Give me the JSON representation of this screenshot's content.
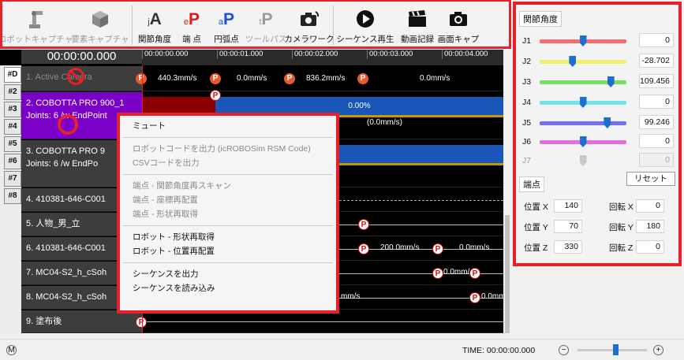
{
  "toolbar": {
    "capture_robot": "ロボットキャプチャ",
    "capture_element": "要素キャプチャ",
    "joint_angle": "関節角度",
    "endpoint": "端 点",
    "arc_point": "円弧点",
    "tool_path": "ツールパス",
    "camera_work": "カメラワーク",
    "play_sequence": "シーケンス再生",
    "record_video": "動画記録",
    "screen_capture": "画面キャプ",
    "icon_glyphs": {
      "joint": "jA",
      "end": "eP",
      "arc": "aP",
      "tool": "tP"
    }
  },
  "timeline": {
    "time": "00:00:00.000",
    "ruler": [
      "00:00:00.000",
      "00:00:01.000",
      "00:00:02.000",
      "00:00:03.000",
      "00:00:04.000"
    ],
    "tabs": [
      "#D",
      "#2",
      "#3",
      "#4",
      "#5",
      "#6",
      "#7",
      "#8"
    ],
    "tracks": [
      {
        "name": "1. Active Camera"
      },
      {
        "name": "2. COBOTTA PRO 900_1",
        "sub": "Joints: 6 /w EndPoint"
      },
      {
        "name": "3. COBOTTA PRO 9",
        "sub": "Joints: 6 /w EndPo"
      },
      {
        "name": "4. 410381-646-C001"
      },
      {
        "name": "5. 人物_男_立"
      },
      {
        "name": "6. 410381-646-C001"
      },
      {
        "name": "7. MC04-S2_h_cSoh"
      },
      {
        "name": "8. MC04-S2_h_cSoh"
      },
      {
        "name": "9. 塗布後"
      }
    ],
    "marker_label": "P",
    "speeds": {
      "t1_a": "440.3mm/s",
      "t1_b": "0.0mm/s",
      "t1_c": "836.2mm/s",
      "t1_d": "0.0mm/s",
      "t2_pct": "0.00%",
      "t2_spd": "(0.0mm/s)",
      "t6_a": "200.0mm/s",
      "t6_b": "0.0mm/s",
      "t7_a": "0.0mm/s",
      "t8_a": "0.0mm/s",
      "t8_b": "mm/s"
    }
  },
  "context_menu": {
    "mute": "ミュート",
    "output_robot_code": "ロボットコードを出力 (icROBOSim RSM Code)",
    "output_csv": "CSVコードを出力",
    "rescan_joint": "端点 - 関節角度再スキャン",
    "relocate_coord": "端点 - 座標再配置",
    "reacquire_shape": "端点 - 形状再取得",
    "robot_reacquire_shape": "ロボット - 形状再取得",
    "robot_relocate": "ロボット - 位置再配置",
    "export_sequence": "シーケンスを出力",
    "import_sequence": "シーケンスを読み込み"
  },
  "joint_panel": {
    "title": "関節角度",
    "joints": [
      {
        "label": "J1",
        "value": "0",
        "pos": 0.5,
        "color": "#f07070"
      },
      {
        "label": "J2",
        "value": "-28.702",
        "pos": 0.38,
        "color": "#f2ef70"
      },
      {
        "label": "J3",
        "value": "109.456",
        "pos": 0.82,
        "color": "#78e060"
      },
      {
        "label": "J4",
        "value": "0",
        "pos": 0.5,
        "color": "#6ee6e8"
      },
      {
        "label": "J5",
        "value": "99.246",
        "pos": 0.78,
        "color": "#7070f0"
      },
      {
        "label": "J6",
        "value": "0",
        "pos": 0.5,
        "color": "#e070e0"
      },
      {
        "label": "J7",
        "value": "0",
        "pos": 0.5,
        "color": "#cfcfcf"
      }
    ],
    "reset": "リセット"
  },
  "endpoint_panel": {
    "title": "端点",
    "pos_x_label": "位置 X",
    "pos_x": "140",
    "pos_y_label": "位置 Y",
    "pos_y": "70",
    "pos_z_label": "位置 Z",
    "pos_z": "330",
    "rot_x_label": "回転 X",
    "rot_x": "0",
    "rot_y_label": "回転 Y",
    "rot_y": "180",
    "rot_z_label": "回転 Z",
    "rot_z": "0"
  },
  "status": {
    "mode": "M",
    "time": "TIME: 00:00:00.000",
    "zoom_level": 0.55
  },
  "colors": {
    "highlight": "#e8202a",
    "selected_track": "#7a00c8",
    "marker": "#e85a2a"
  }
}
